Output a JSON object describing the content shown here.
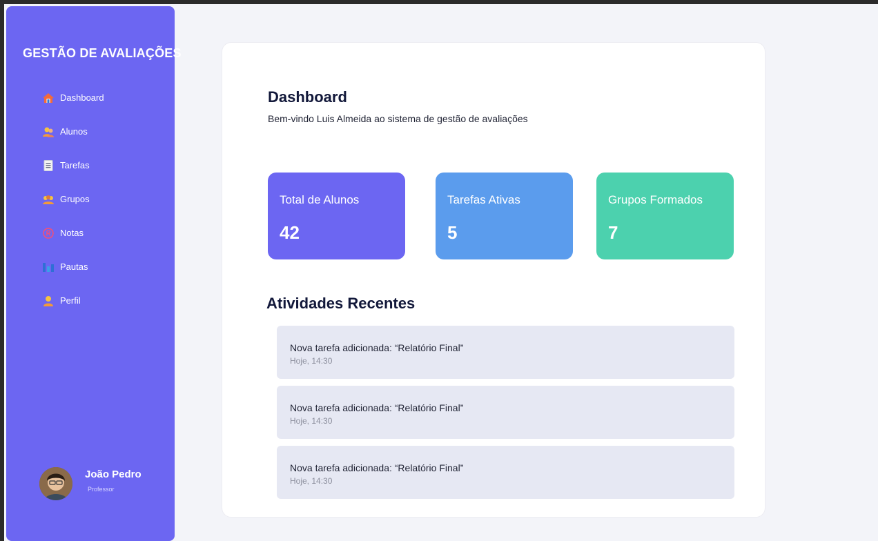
{
  "sidebar": {
    "brand": "GESTÃO DE AVALIAÇÕES",
    "items": [
      {
        "label": "Dashboard",
        "icon": "house-icon"
      },
      {
        "label": "Alunos",
        "icon": "students-icon"
      },
      {
        "label": "Tarefas",
        "icon": "clipboard-icon"
      },
      {
        "label": "Grupos",
        "icon": "group-icon"
      },
      {
        "label": "Notas",
        "icon": "grade-icon"
      },
      {
        "label": "Pautas",
        "icon": "bar-chart-icon"
      },
      {
        "label": "Perfil",
        "icon": "person-icon"
      }
    ],
    "user": {
      "name": "João Pedro",
      "role": "Professor"
    }
  },
  "main": {
    "title": "Dashboard",
    "welcome": "Bem-vindo Luis Almeida ao sistema de gestão de avaliações",
    "stats": [
      {
        "label": "Total de Alunos",
        "value": "42",
        "color": "#6c66f2"
      },
      {
        "label": "Tarefas Ativas",
        "value": "5",
        "color": "#5b9ced"
      },
      {
        "label": "Grupos Formados",
        "value": "7",
        "color": "#4cd1ae"
      }
    ],
    "activities_title": "Atividades Recentes",
    "activities": [
      {
        "text": "Nova tarefa adicionada: “Relatório Final”",
        "time": "Hoje, 14:30"
      },
      {
        "text": "Nova tarefa adicionada: “Relatório Final”",
        "time": "Hoje, 14:30"
      },
      {
        "text": "Nova tarefa adicionada: “Relatório Final”",
        "time": "Hoje, 14:30"
      }
    ]
  },
  "colors": {
    "accent": "#6c66f2",
    "background": "#f3f4f9"
  }
}
